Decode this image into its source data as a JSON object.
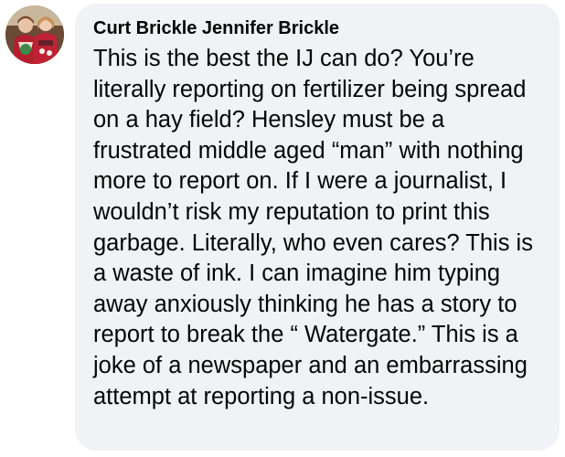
{
  "comment": {
    "author": "Curt Brickle Jennifer Brickle",
    "avatar_icon": "profile-photo",
    "text": "This is the best the IJ can do? You’re literally reporting on fertilizer being spread on a hay field? Hensley must be a frustrated middle aged “man” with nothing more to report on. If I were a journalist, I wouldn’t risk my reputation to print this garbage. Literally, who even cares? This is a waste of ink. I can imagine him typing away anxiously thinking he has a story to report to break the “ Watergate.” This is a joke of a newspaper and an embarrassing attempt at reporting a non-issue."
  },
  "colors": {
    "bubble_background": "#f0f2f5",
    "text": "#050505"
  }
}
